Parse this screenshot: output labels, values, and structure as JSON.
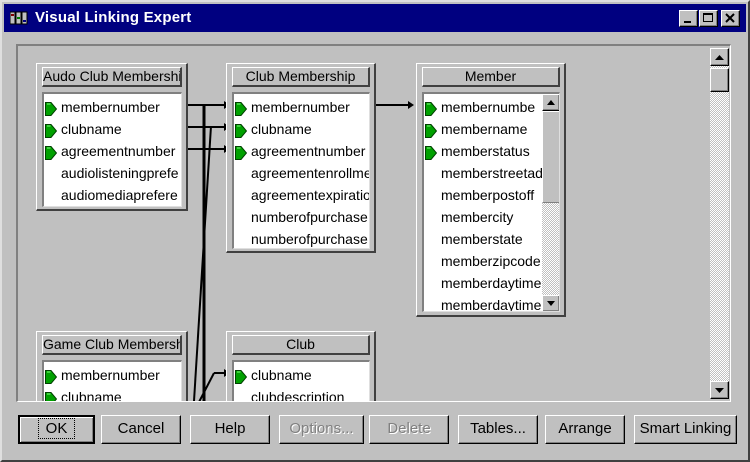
{
  "window": {
    "title": "Visual Linking Expert"
  },
  "colors": {
    "titlebar": "#000080",
    "key_icon": "#00a000",
    "face": "#c0c0c0"
  },
  "icons": [
    "app-icon",
    "minimize-icon",
    "maximize-icon",
    "close-icon",
    "scroll-up-icon",
    "scroll-down-icon",
    "key-icon"
  ],
  "tables": [
    {
      "name": "Audo Club Membership",
      "fields": [
        {
          "name": "membernumber",
          "key": true
        },
        {
          "name": "clubname",
          "key": true
        },
        {
          "name": "agreementnumber",
          "key": true
        },
        {
          "name": "audiolisteningprefe",
          "key": false
        },
        {
          "name": "audiomediaprefere",
          "key": false
        }
      ]
    },
    {
      "name": "Club Membership",
      "fields": [
        {
          "name": "membernumber",
          "key": true
        },
        {
          "name": "clubname",
          "key": true
        },
        {
          "name": "agreementnumber",
          "key": true
        },
        {
          "name": "agreementenrollme",
          "key": false
        },
        {
          "name": "agreementexpiratio",
          "key": false
        },
        {
          "name": "numberofpurchase",
          "key": false
        },
        {
          "name": "numberofpurchase",
          "key": false
        }
      ]
    },
    {
      "name": "Member",
      "fields": [
        {
          "name": "membernumbe",
          "key": true
        },
        {
          "name": "membername",
          "key": true
        },
        {
          "name": "memberstatus",
          "key": true
        },
        {
          "name": "memberstreetad",
          "key": false
        },
        {
          "name": "memberpostoff",
          "key": false
        },
        {
          "name": "membercity",
          "key": false
        },
        {
          "name": "memberstate",
          "key": false
        },
        {
          "name": "memberzipcode",
          "key": false
        },
        {
          "name": "memberdaytime",
          "key": false
        },
        {
          "name": "memberdaytime",
          "key": false
        }
      ]
    },
    {
      "name": "Game Club Membership",
      "fields": [
        {
          "name": "membernumber",
          "key": true
        },
        {
          "name": "clubname",
          "key": true
        }
      ]
    },
    {
      "name": "Club",
      "fields": [
        {
          "name": "clubname",
          "key": true
        },
        {
          "name": "clubdescription",
          "key": false
        }
      ]
    }
  ],
  "buttons": [
    {
      "label": "OK",
      "enabled": true,
      "default": true
    },
    {
      "label": "Cancel",
      "enabled": true
    },
    {
      "label": "Help",
      "enabled": true
    },
    {
      "label": "Options...",
      "enabled": false
    },
    {
      "label": "Delete",
      "enabled": false
    },
    {
      "label": "Tables...",
      "enabled": true
    },
    {
      "label": "Arrange",
      "enabled": true
    },
    {
      "label": "Smart Linking",
      "enabled": true
    }
  ]
}
